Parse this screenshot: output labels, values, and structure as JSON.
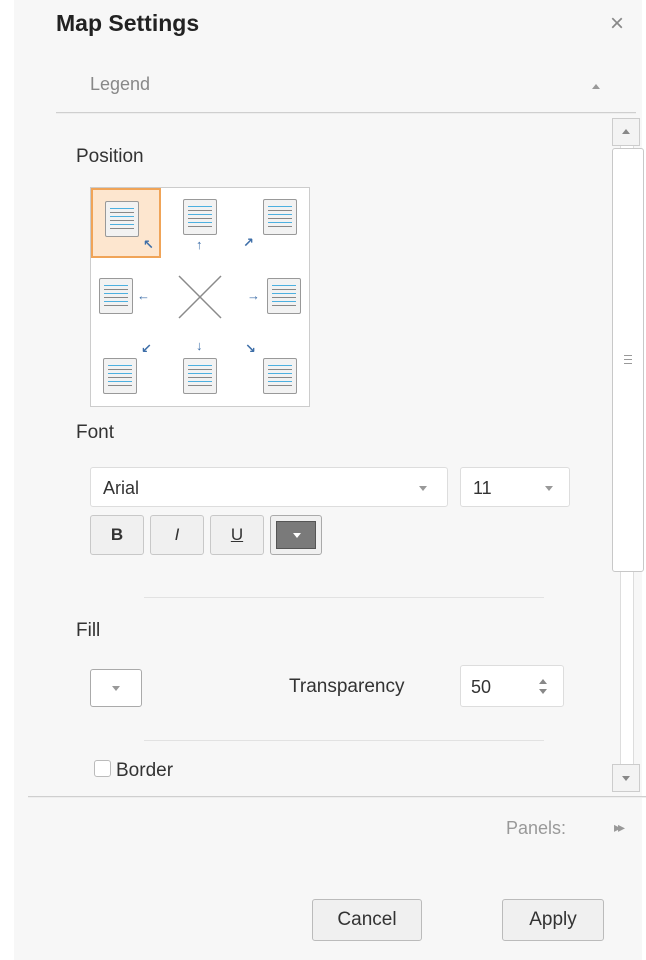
{
  "dialog": {
    "title": "Map Settings",
    "close_glyph": "×"
  },
  "section": {
    "title": "Legend"
  },
  "position": {
    "label": "Position",
    "selected": "top-left",
    "cells": [
      "top-left",
      "top-center",
      "top-right",
      "middle-left",
      "none",
      "middle-right",
      "bottom-left",
      "bottom-center",
      "bottom-right"
    ],
    "arrows": {
      "top-left": "↖",
      "top-center": "↑",
      "top-right": "↗",
      "middle-left": "←",
      "middle-right": "→",
      "bottom-left": "↙",
      "bottom-center": "↓",
      "bottom-right": "↘"
    }
  },
  "font": {
    "label": "Font",
    "family": "Arial",
    "size": "11",
    "bold": "B",
    "italic": "I",
    "underline": "U"
  },
  "fill": {
    "label": "Fill",
    "transparency_label": "Transparency",
    "transparency_value": "50"
  },
  "border": {
    "label": "Border",
    "checked": false
  },
  "footer": {
    "panels_label": "Panels:",
    "panels_arrow": "▸▸",
    "cancel": "Cancel",
    "apply": "Apply"
  },
  "colors": {
    "selection_fill": "#fde6cf",
    "selection_border": "#f0a458",
    "arrow": "#3d6ea8",
    "font_color_swatch": "#7a7a7a"
  }
}
